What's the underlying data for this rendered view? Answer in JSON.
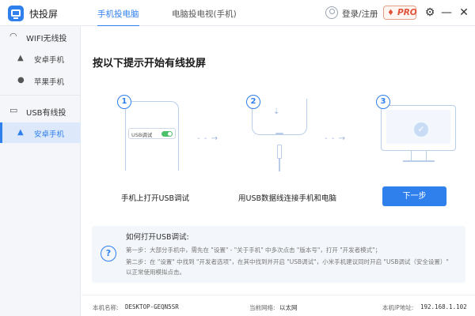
{
  "app": {
    "title": "快投屏"
  },
  "tabs": [
    {
      "label": "手机投电脑",
      "active": true
    },
    {
      "label": "电脑投电视(手机)",
      "active": false
    }
  ],
  "header": {
    "login_label": "登录/注册",
    "pro_label": "PRO"
  },
  "sidebar": {
    "groups": [
      {
        "label": "WIFI无线投",
        "icon": "wifi-icon",
        "items": [
          {
            "label": "安卓手机",
            "icon": "android-icon",
            "active": false
          },
          {
            "label": "苹果手机",
            "icon": "apple-icon",
            "active": false
          }
        ]
      },
      {
        "label": "USB有线投",
        "icon": "usb-device-icon",
        "items": [
          {
            "label": "安卓手机",
            "icon": "android-icon",
            "active": true
          }
        ]
      }
    ]
  },
  "main": {
    "heading": "按以下提示开始有线投屏",
    "steps": [
      {
        "number": "1",
        "label": "手机上打开USB调试",
        "pill_label": "USB调试"
      },
      {
        "number": "2",
        "label": "用USB数据线连接手机和电脑"
      },
      {
        "number": "3"
      }
    ],
    "next_button": "下一步"
  },
  "help": {
    "title": "如何打开USB调试:",
    "line1": "第一步：大部分手机中，需先在 \"设置\" - \"关于手机\" 中多次点击 \"版本号\"，打开 \"开发者模式\"；",
    "line2": "第二步：在 \"设置\" 中找到 \"开发者选项\"，在其中找到并开启 \"USB调试\"，小米手机建议同时开启 \"USB调试（安全设置）\"",
    "line3": "以正常使用模拟点击。"
  },
  "footer": {
    "machine_label": "本机名称:",
    "machine_value": "DESKTOP-GEQN5SR",
    "network_label": "当前网络:",
    "network_value": "以太网",
    "ip_label": "本机IP地址:",
    "ip_value": "192.168.1.102"
  },
  "colors": {
    "accent": "#2f80ed",
    "toggle_on": "#4cc06a",
    "pro": "#e0533a"
  }
}
